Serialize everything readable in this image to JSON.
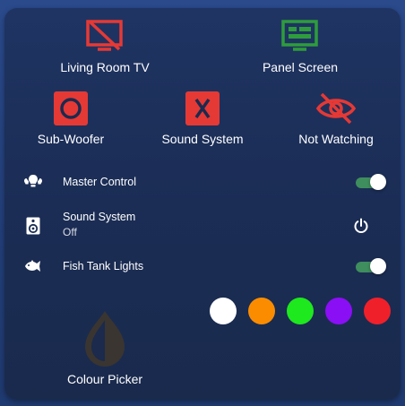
{
  "buttons": {
    "living_room_tv": {
      "label": "Living Room TV",
      "icon": "tv-off-icon",
      "color": "#e53935"
    },
    "panel_screen": {
      "label": "Panel Screen",
      "icon": "tv-guide-icon",
      "color": "#2e9c3c"
    },
    "sub_woofer": {
      "label": "Sub-Woofer",
      "icon": "record-icon",
      "color": "#e53935"
    },
    "sound_system": {
      "label": "Sound System",
      "icon": "close-box-icon",
      "color": "#e53935"
    },
    "not_watching": {
      "label": "Not Watching",
      "icon": "eye-off-icon",
      "color": "#e53935"
    }
  },
  "rows": {
    "master_control": {
      "label": "Master Control",
      "icon": "lightbulb-group-icon",
      "state": "on"
    },
    "sound_system": {
      "label": "Sound System",
      "status": "Off",
      "icon": "speaker-icon",
      "action_icon": "power-icon"
    },
    "fish_tank_lights": {
      "label": "Fish Tank Lights",
      "icon": "fish-icon",
      "state": "on"
    }
  },
  "colour_swatches": [
    {
      "name": "white",
      "color": "#ffffff"
    },
    {
      "name": "orange",
      "color": "#fb8c00"
    },
    {
      "name": "green",
      "color": "#1ee81e"
    },
    {
      "name": "purple",
      "color": "#8a0ff5"
    },
    {
      "name": "red",
      "color": "#f0202a"
    }
  ],
  "colour_picker": {
    "label": "Colour Picker",
    "icon": "invert-colors-icon",
    "color": "#3a3530"
  },
  "accent": {
    "toggle_on": "#3f8e5e"
  }
}
